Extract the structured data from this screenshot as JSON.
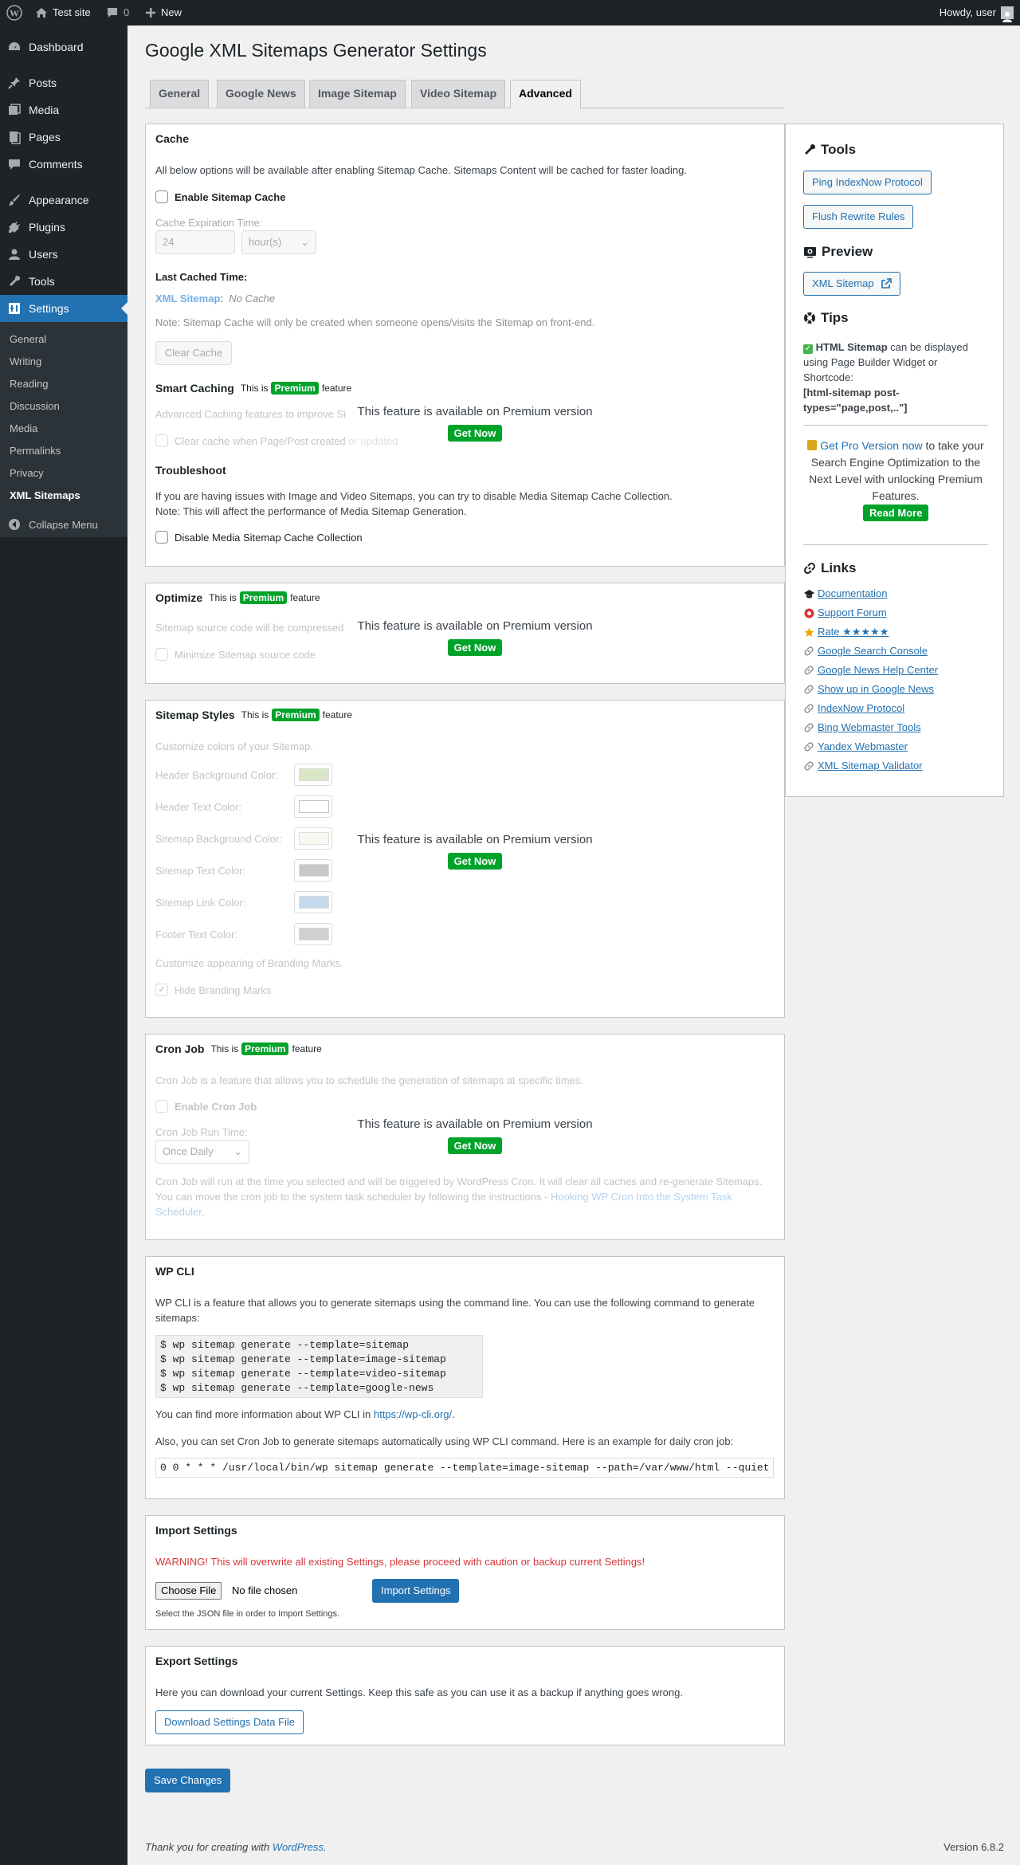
{
  "adminbar": {
    "site_name": "Test site",
    "comments_count": "0",
    "new_label": "New",
    "howdy": "Howdy, user"
  },
  "sidebar": {
    "items": [
      {
        "label": "Dashboard",
        "icon": "dashboard-icon"
      },
      {
        "label": "Posts",
        "icon": "pin-icon"
      },
      {
        "label": "Media",
        "icon": "media-icon"
      },
      {
        "label": "Pages",
        "icon": "page-icon"
      },
      {
        "label": "Comments",
        "icon": "comment-icon"
      },
      {
        "label": "Appearance",
        "icon": "brush-icon"
      },
      {
        "label": "Plugins",
        "icon": "plug-icon"
      },
      {
        "label": "Users",
        "icon": "user-icon"
      },
      {
        "label": "Tools",
        "icon": "wrench-icon"
      },
      {
        "label": "Settings",
        "icon": "settings-icon"
      }
    ],
    "submenu": [
      "General",
      "Writing",
      "Reading",
      "Discussion",
      "Media",
      "Permalinks",
      "Privacy",
      "XML Sitemaps"
    ],
    "collapse": "Collapse Menu"
  },
  "page": {
    "title": "Google XML Sitemaps Generator Settings",
    "tabs": [
      "General",
      "Google News",
      "Image Sitemap",
      "Video Sitemap",
      "Advanced"
    ],
    "active_tab": "Advanced"
  },
  "premium": {
    "is_this": "This is",
    "badge": "Premium",
    "feature": "feature",
    "overlay_text": "This feature is available on Premium version",
    "get_now": "Get Now"
  },
  "cache": {
    "title": "Cache",
    "intro": "All below options will be available after enabling Sitemap Cache. Sitemaps Content will be cached for faster loading.",
    "enable_label": "Enable Sitemap Cache",
    "expiration_label": "Cache Expiration Time:",
    "expiration_value": "24",
    "expiration_unit": "hour(s)",
    "last_cached_title": "Last Cached Time:",
    "xml_sitemap_link": "XML Sitemap",
    "colon": ":",
    "no_cache": "No Cache",
    "note": "Note: Sitemap Cache will only be created when someone opens/visits the Sitemap on front-end.",
    "clear_cache": "Clear Cache",
    "smart_title": "Smart Caching",
    "smart_desc": "Advanced Caching features to improve Si",
    "smart_cb": "Clear cache when Page/Post created",
    "smart_cb_tail": "or updated",
    "trouble_title": "Troubleshoot",
    "trouble_p1": "If you are having issues with Image and Video Sitemaps, you can try to disable Media Sitemap Cache Collection.",
    "trouble_p2": "Note: This will affect the performance of Media Sitemap Generation.",
    "trouble_cb": "Disable Media Sitemap Cache Collection"
  },
  "optimize": {
    "title": "Optimize",
    "desc": "Sitemap source code will be compressed",
    "cb": "Minimize Sitemap source code"
  },
  "styles": {
    "title": "Sitemap Styles",
    "desc": "Customize colors of your Sitemap.",
    "colors": [
      {
        "label": "Header Background Color:",
        "color": "#d9e7c7"
      },
      {
        "label": "Header Text Color:",
        "color": "#ffffff"
      },
      {
        "label": "Sitemap Background Color:",
        "color": "#f8f9f2"
      },
      {
        "label": "Sitemap Text Color:",
        "color": "#c8c8c8"
      },
      {
        "label": "Sitemap Link Color:",
        "color": "#c5d9ec"
      },
      {
        "label": "Footer Text Color:",
        "color": "#d0d0d0"
      }
    ],
    "branding_desc": "Customize appearing of Branding Marks.",
    "hide_branding": "Hide Branding Marks"
  },
  "cron": {
    "title": "Cron Job",
    "desc": "Cron Job is a feature that allows you to schedule the generation of sitemaps at specific times.",
    "enable": "Enable Cron Job",
    "run_time_label": "Cron Job Run Time:",
    "run_time_value": "Once Daily",
    "note1": "Cron Job will run at the time you selected and will be triggered by WordPress Cron. It will clear all caches and re-generate Sitemaps.",
    "note2": "You can move the cron job to the system task scheduler by following the instructions - ",
    "link": "Hooking WP Cron Into the System Task",
    "link2": "Scheduler",
    "period": "."
  },
  "wpcli": {
    "title": "WP CLI",
    "desc1": "WP CLI is a feature that allows you to generate sitemaps using the command line. You can use the following command to generate",
    "desc2": "sitemaps:",
    "commands": "$ wp sitemap generate --template=sitemap\n$ wp sitemap generate --template=image-sitemap\n$ wp sitemap generate --template=video-sitemap\n$ wp sitemap generate --template=google-news",
    "more_info": "You can find more information about WP CLI in ",
    "more_link": "https://wp-cli.org/",
    "period": ".",
    "cron_info": "Also, you can set Cron Job to generate sitemaps automatically using WP CLI command. Here is an example for daily cron job:",
    "cron_cmd": "0 0 * * * /usr/local/bin/wp sitemap generate --template=image-sitemap --path=/var/www/html --quiet"
  },
  "import": {
    "title": "Import Settings",
    "warning": "WARNING! This will overwrite all existing Settings, please proceed with caution or backup current Settings!",
    "choose_file": "Choose File",
    "no_file": "No file chosen",
    "button": "Import Settings",
    "help": "Select the JSON file in order to Import Settings."
  },
  "export": {
    "title": "Export Settings",
    "desc": "Here you can download your current Settings. Keep this safe as you can use it as a backup if anything goes wrong.",
    "button": "Download Settings Data File"
  },
  "save_button": "Save Changes",
  "right": {
    "tools_title": "Tools",
    "ping_button": "Ping IndexNow Protocol",
    "flush_button": "Flush Rewrite Rules",
    "preview_title": "Preview",
    "xml_sitemap_button": "XML Sitemap",
    "tips_title": "Tips",
    "tip_bold": "HTML Sitemap",
    "tip_text1": " can be displayed",
    "tip_text2": "using Page Builder Widget or",
    "tip_text3": "Shortcode:",
    "tip_code1": "[html-sitemap post-",
    "tip_code2": "types=\"page,post,..\"]",
    "pro_link": "Get Pro Version now",
    "pro_text1": " to take your",
    "pro_text2": "Search Engine Optimization to the",
    "pro_text3": "Next Level with unlocking Premium",
    "pro_text4": "Features.",
    "read_more": "Read More",
    "links_title": "Links",
    "links": [
      {
        "label": "Documentation",
        "icon": "graduation-cap-icon"
      },
      {
        "label": "Support Forum",
        "icon": "lifebuoy-icon"
      },
      {
        "label": "Rate ★★★★★",
        "icon": "star-icon"
      },
      {
        "label": "Google Search Console",
        "icon": "link-icon"
      },
      {
        "label": "Google News Help Center",
        "icon": "link-icon"
      },
      {
        "label": "Show up in Google News",
        "icon": "link-icon"
      },
      {
        "label": "IndexNow Protocol",
        "icon": "link-icon"
      },
      {
        "label": "Bing Webmaster Tools",
        "icon": "link-icon"
      },
      {
        "label": "Yandex Webmaster",
        "icon": "link-icon"
      },
      {
        "label": "XML Sitemap Validator",
        "icon": "link-icon"
      }
    ]
  },
  "footer": {
    "thanks": "Thank you for creating with ",
    "wp_link": "WordPress",
    "period": ".",
    "version": "Version 6.8.2"
  }
}
